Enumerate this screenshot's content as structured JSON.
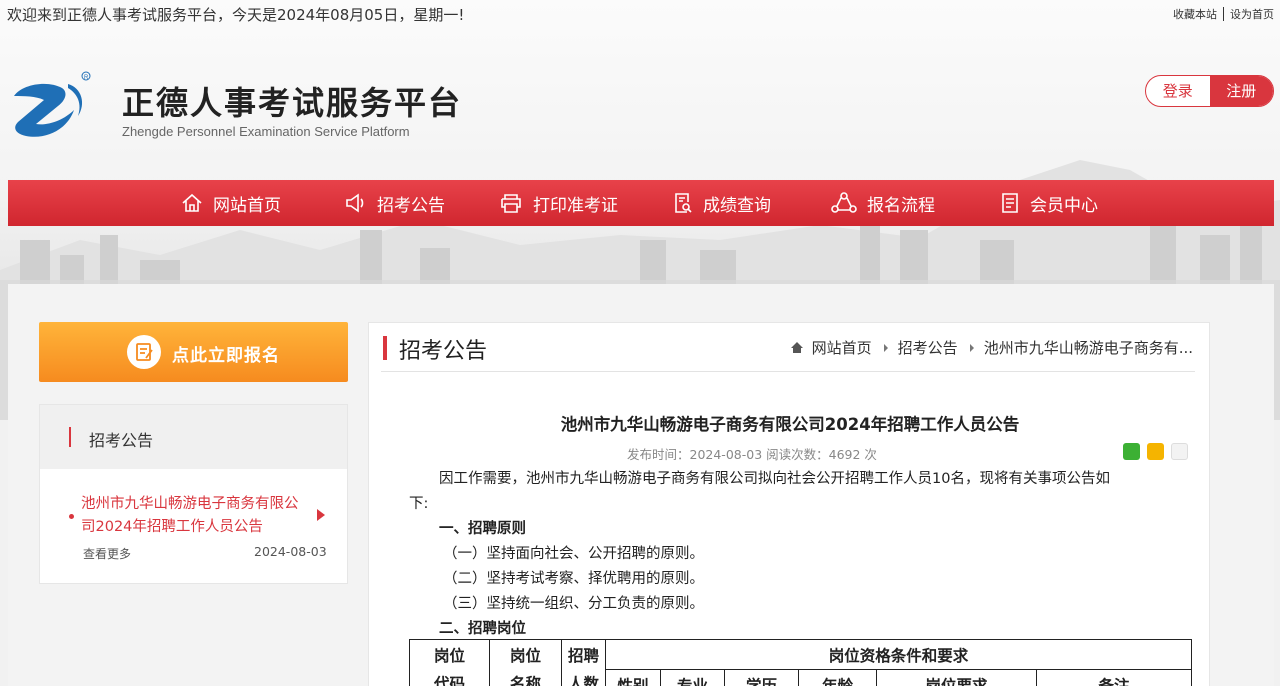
{
  "topbar": {
    "welcome": "欢迎来到正德人事考试服务平台，今天是2024年08月05日，星期一!",
    "bookmark": "收藏本站",
    "set_home": "设为首页"
  },
  "header": {
    "title": "正德人事考试服务平台",
    "subtitle": "Zhengde Personnel Examination Service Platform",
    "login": "登录",
    "register": "注册"
  },
  "nav": {
    "items": [
      {
        "label": "网站首页",
        "icon": "home-icon"
      },
      {
        "label": "招考公告",
        "icon": "megaphone-icon"
      },
      {
        "label": "打印准考证",
        "icon": "printer-icon"
      },
      {
        "label": "成绩查询",
        "icon": "search-document-icon"
      },
      {
        "label": "报名流程",
        "icon": "process-icon"
      },
      {
        "label": "会员中心",
        "icon": "member-icon"
      }
    ]
  },
  "sidebar": {
    "signup_banner": "点此立即报名",
    "section_title": "招考公告",
    "item": {
      "title": "池州市九华山畅游电子商务有限公司2024年招聘工作人员公告",
      "more": "查看更多",
      "date": "2024-08-03"
    }
  },
  "main": {
    "page_title": "招考公告",
    "breadcrumb": [
      "网站首页",
      "招考公告",
      "池州市九华山畅游电子商务有..."
    ],
    "article": {
      "title": "池州市九华山畅游电子商务有限公司2024年招聘工作人员公告",
      "meta": "发布时间：2024-08-03    阅读次数：4692 次",
      "intro": "因工作需要，池州市九华山畅游电子商务有限公司拟向社会公开招聘工作人员10名，现将有关事项公告如",
      "intro_cont": "下:",
      "section1": "一、招聘原则",
      "p1": "（一）坚持面向社会、公开招聘的原则。",
      "p2": "（二）坚持考试考察、择优聘用的原则。",
      "p3": "（三）坚持统一组织、分工负责的原则。",
      "section2": "二、招聘岗位"
    },
    "table": {
      "col1": [
        "岗位",
        "代码"
      ],
      "col2": [
        "岗位",
        "名称"
      ],
      "col3": [
        "招聘",
        "人数"
      ],
      "group": "岗位资格条件和要求",
      "sub": [
        "性别",
        "专业",
        "学历",
        "年龄",
        "岗位要求",
        "备注"
      ]
    }
  },
  "colors": {
    "accent": "#d9363e",
    "banner_orange": "#f68b1f"
  }
}
